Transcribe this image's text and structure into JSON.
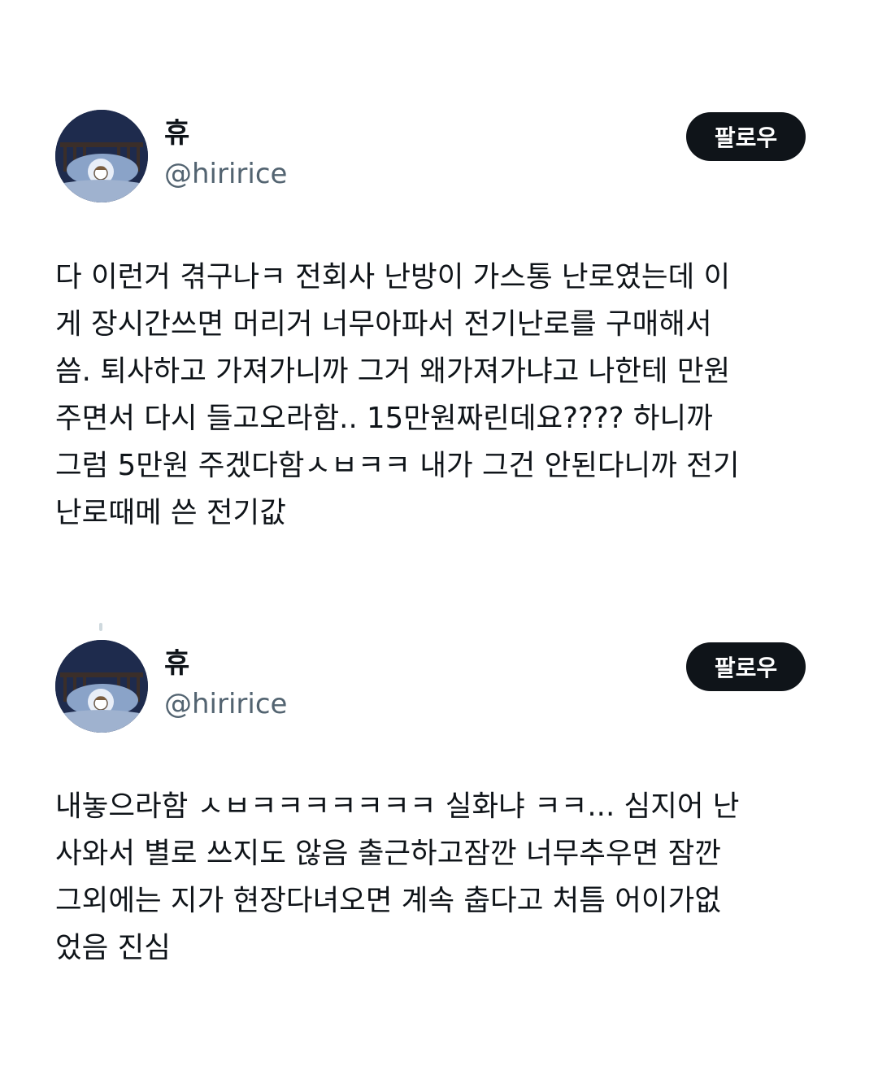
{
  "tweets": [
    {
      "author": {
        "display_name": "휴",
        "handle": "@hiririce",
        "avatar_icon": "sleeping-character-avatar"
      },
      "follow_label": "팔로우",
      "text": "다 이런거 겪구나ㅋ 전회사 난방이 가스통 난로였는데 이\n게 장시간쓰면 머리거 너무아파서 전기난로를 구매해서\n씀. 퇴사하고 가져가니까 그거 왜가져가냐고 나한테 만원\n주면서 다시 들고오라함.. 15만원짜린데요???? 하니까\n그럼 5만원 주겠다함ㅅㅂㅋㅋ 내가 그건 안된다니까 전기\n난로때메 쓴 전기값"
    },
    {
      "author": {
        "display_name": "휴",
        "handle": "@hiririce",
        "avatar_icon": "sleeping-character-avatar"
      },
      "follow_label": "팔로우",
      "text": "내놓으라함 ㅅㅂㅋㅋㅋㅋㅋㅋㅋ 실화냐 ㅋㅋ... 심지어 난\n사와서 별로 쓰지도 않음 출근하고잠깐 너무추우면 잠깐\n그외에는 지가 현장다녀오면 계속 춥다고 처틈 어이가없\n었음 진심"
    }
  ],
  "colors": {
    "text_primary": "#0f1419",
    "text_secondary": "#536471",
    "button_bg": "#0f1419",
    "button_text": "#ffffff"
  }
}
